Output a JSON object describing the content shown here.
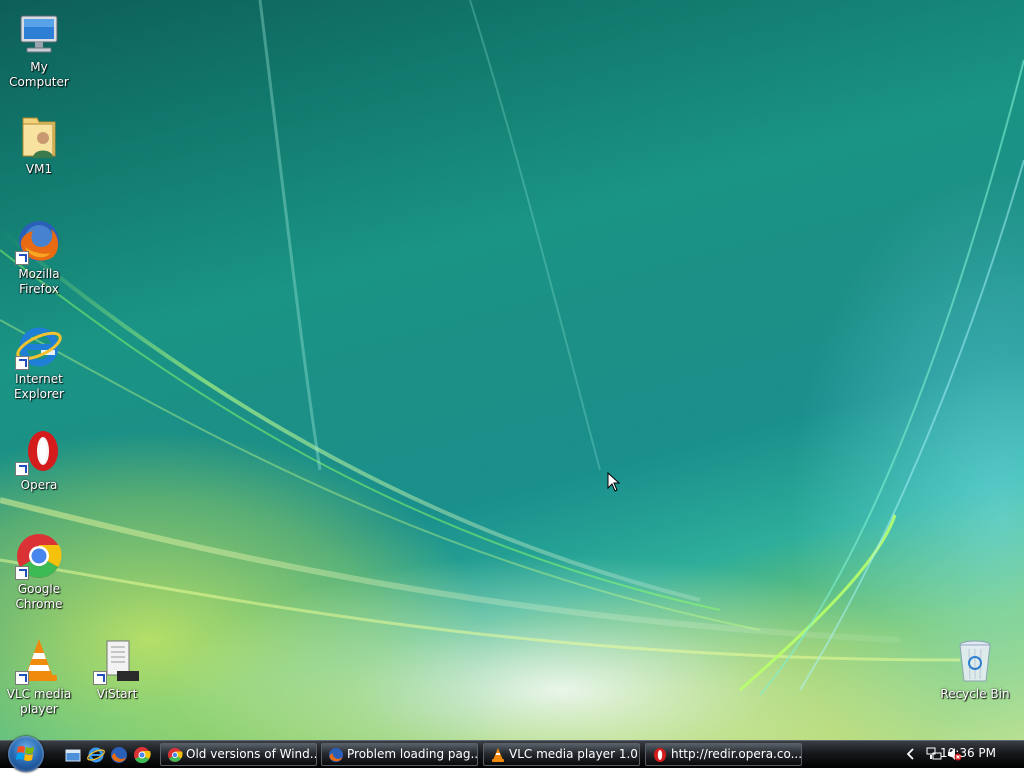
{
  "desktop": {
    "icons": [
      {
        "label": "My Computer",
        "icon": "computer-icon"
      },
      {
        "label": "VM1",
        "icon": "user-folder-icon"
      },
      {
        "label": "Mozilla Firefox",
        "icon": "firefox-icon"
      },
      {
        "label": "Internet Explorer",
        "icon": "internet-explorer-icon"
      },
      {
        "label": "Opera",
        "icon": "opera-icon"
      },
      {
        "label": "Google Chrome",
        "icon": "chrome-icon"
      },
      {
        "label": "VLC media player",
        "icon": "vlc-icon"
      },
      {
        "label": "ViStart",
        "icon": "vistart-icon"
      },
      {
        "label": "Recycle Bin",
        "icon": "recycle-bin-icon"
      }
    ]
  },
  "taskbar": {
    "start_icon": "windows-start-icon",
    "quick_launch": [
      "show-desktop-icon",
      "internet-explorer-icon",
      "firefox-icon",
      "chrome-icon"
    ],
    "buttons": [
      {
        "label": "Old versions of Wind...",
        "icon": "chrome-icon"
      },
      {
        "label": "Problem loading pag...",
        "icon": "firefox-icon"
      },
      {
        "label": "VLC media player 1.0....",
        "icon": "vlc-icon"
      },
      {
        "label": "http://redir.opera.co...",
        "icon": "opera-icon"
      }
    ],
    "tray": {
      "icons": [
        "show-hidden-icons-chevron",
        "network-icon",
        "volume-muted-icon"
      ],
      "clock": "10:36 PM"
    }
  },
  "colors": {
    "wallpaper_teal": "#1a8f86",
    "wallpaper_yellow": "#c8e07a",
    "taskbar_black": "#000000"
  }
}
